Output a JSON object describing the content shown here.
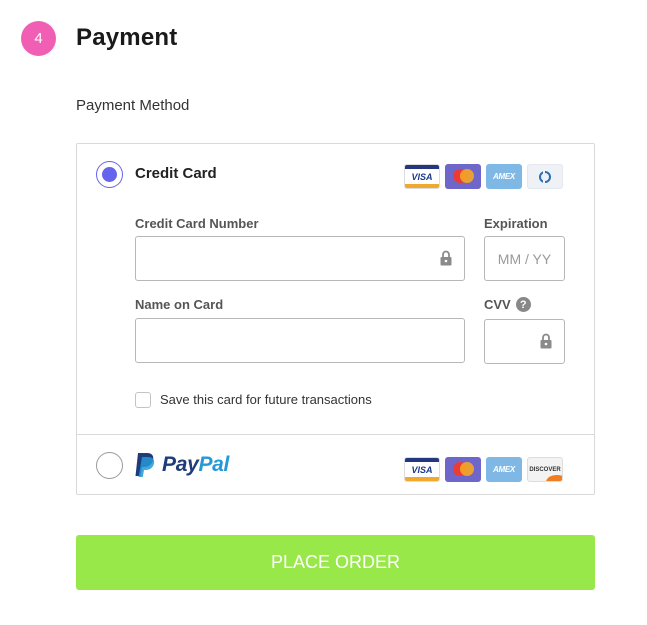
{
  "step": {
    "number": "4",
    "title": "Payment"
  },
  "payment_method_label": "Payment Method",
  "credit_card": {
    "label": "Credit Card",
    "selected": true,
    "card_icons": [
      "visa-icon",
      "mastercard-icon",
      "amex-icon",
      "diners-club-icon"
    ],
    "visa_text": "VISA",
    "amex_text": "AMEX",
    "fields": {
      "number_label": "Credit Card Number",
      "number_value": "",
      "expiration_label": "Expiration",
      "expiration_placeholder": "MM / YY",
      "name_label": "Name on Card",
      "name_value": "",
      "cvv_label": "CVV",
      "cvv_value": ""
    },
    "save_card": {
      "label": "Save this card for future transactions",
      "checked": false
    }
  },
  "paypal": {
    "selected": false,
    "logo_pay": "Pay",
    "logo_pal": "Pal",
    "card_icons": [
      "visa-icon",
      "mastercard-icon",
      "amex-icon",
      "discover-icon"
    ],
    "visa_text": "VISA",
    "amex_text": "AMEX",
    "discover_text": "DISCOVER"
  },
  "place_order_label": "PLACE ORDER",
  "colors": {
    "step_badge": "#f15fb4",
    "radio_selected": "#6564ec",
    "place_order": "#98e84a",
    "paypal_dark": "#1e3b7a",
    "paypal_light": "#2598d6"
  }
}
